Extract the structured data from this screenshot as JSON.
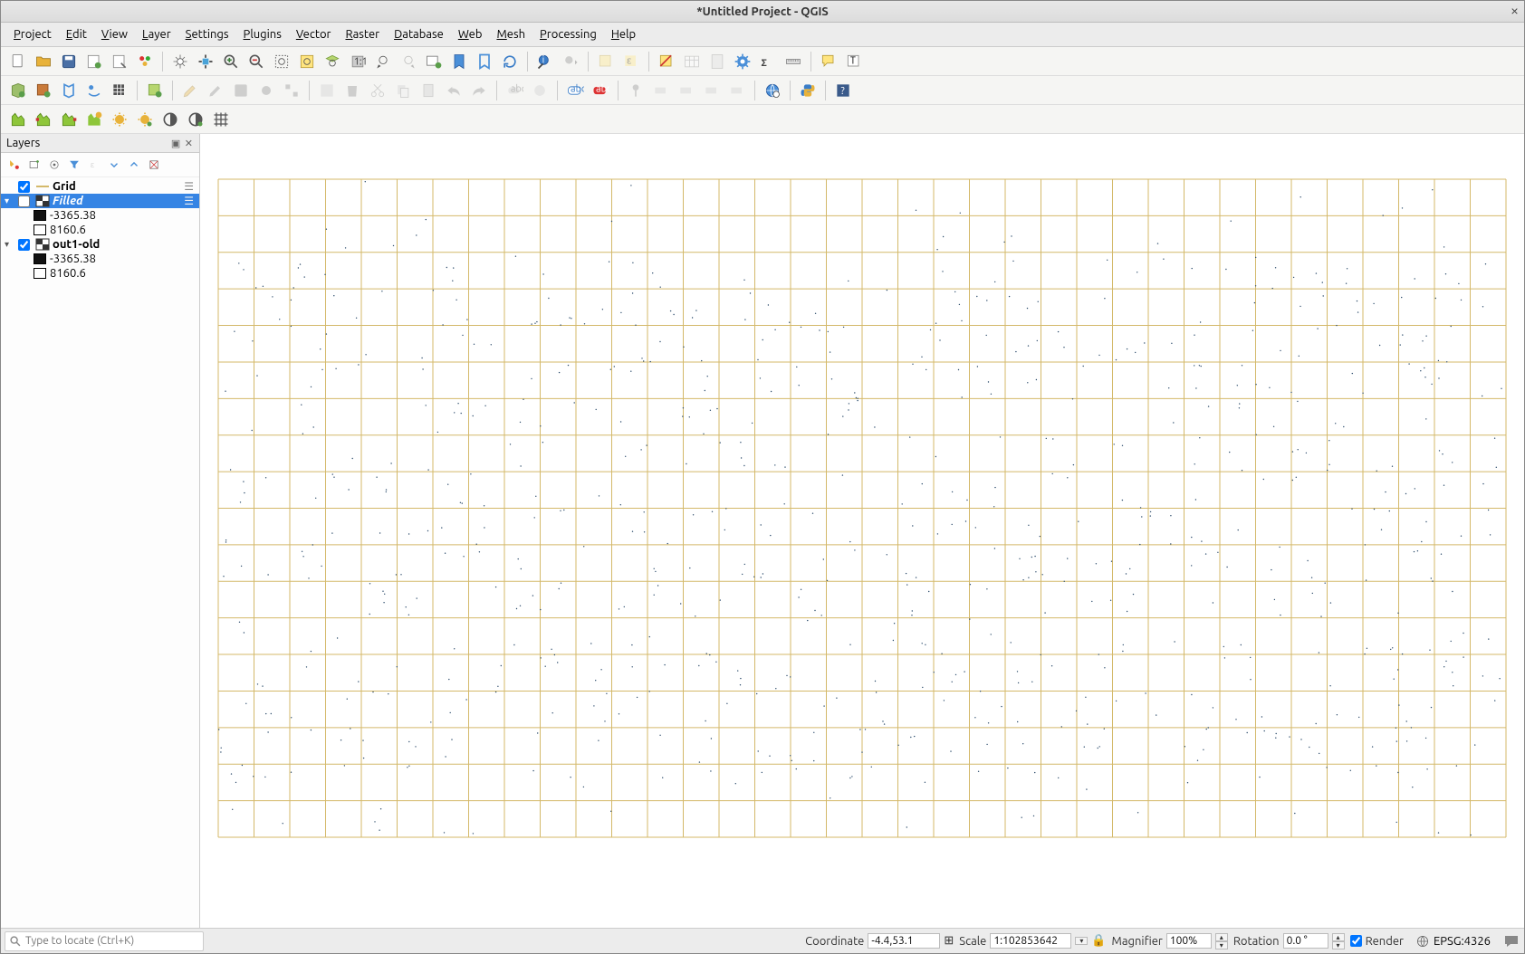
{
  "window": {
    "title": "*Untitled Project - QGIS"
  },
  "menu": {
    "items": [
      "Project",
      "Edit",
      "View",
      "Layer",
      "Settings",
      "Plugins",
      "Vector",
      "Raster",
      "Database",
      "Web",
      "Mesh",
      "Processing",
      "Help"
    ]
  },
  "layersPanel": {
    "title": "Layers",
    "layers": [
      {
        "name": "Grid",
        "checked": true,
        "selected": false,
        "expandable": false,
        "actionsIcon": true
      },
      {
        "name": "Filled",
        "checked": false,
        "selected": true,
        "expandable": true,
        "italic": true,
        "actionsIcon": true,
        "children": [
          {
            "swatch": "#111",
            "label": "-3365.38"
          },
          {
            "swatch": "#fff",
            "label": "8160.6"
          }
        ]
      },
      {
        "name": "out1-old",
        "checked": true,
        "selected": false,
        "expandable": true,
        "children": [
          {
            "swatch": "#111",
            "label": "-3365.38"
          },
          {
            "swatch": "#fff",
            "label": "8160.6"
          }
        ]
      }
    ]
  },
  "status": {
    "locator_placeholder": "Type to locate (Ctrl+K)",
    "coordinate_label": "Coordinate",
    "coordinate_value": "-4.4,53.1",
    "scale_label": "Scale",
    "scale_value": "1:102853642",
    "magnifier_label": "Magnifier",
    "magnifier_value": "100%",
    "rotation_label": "Rotation",
    "rotation_value": "0.0 °",
    "render_label": "Render",
    "render_checked": true,
    "crs": "EPSG:4326"
  },
  "mapgrid": {
    "cols": 36,
    "rows": 18,
    "color": "#d4b96a"
  }
}
